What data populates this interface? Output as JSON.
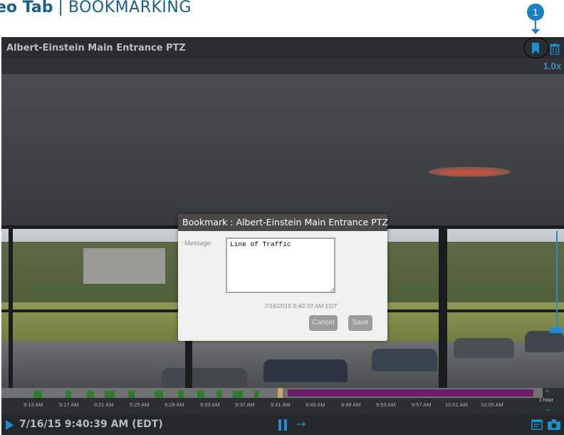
{
  "header": {
    "title_bold": "eo Tab",
    "separator": "|",
    "subtitle": "BOOKMARKING",
    "callout_number": "1"
  },
  "player": {
    "camera_title": "Albert-Einstein Main Entrance PTZ",
    "zoom_level": "1.0x",
    "icons": {
      "bookmark": "bookmark-icon",
      "trash": "trash-icon",
      "play": "play-icon",
      "pause": "pause-icon",
      "forward": "arrow-right-icon",
      "calendar": "calendar-icon",
      "snapshot": "camera-icon"
    }
  },
  "modal": {
    "title": "Bookmark : Albert-Einstein Main Entrance PTZ",
    "message_label": "Message:",
    "message_value": "Line of Traffic",
    "timestamp": "7/16/2015 9:40:33 AM EDT",
    "cancel_label": "Cancel",
    "save_label": "Save"
  },
  "timeline": {
    "ticks": [
      "9:13 AM",
      "9:17 AM",
      "9:21 AM",
      "9:25 AM",
      "9:29 AM",
      "9:33 AM",
      "9:37 AM",
      "9:41 AM",
      "9:45 AM",
      "9:49 AM",
      "9:53 AM",
      "9:57 AM",
      "10:01 AM",
      "10:05 AM"
    ],
    "zoom_plus": "+",
    "zoom_label": "1 hour",
    "zoom_minus": "−"
  },
  "controls": {
    "datetime": "7/16/15 9:40:39 AM (EDT)",
    "forward_glyph": "→"
  },
  "colors": {
    "accent": "#1c8fd0",
    "header_text": "#1a5e8c",
    "recording_green": "#2e7d2e",
    "bookmark_purple": "#6d1c6a",
    "modal_button": "#9c9c9c"
  }
}
